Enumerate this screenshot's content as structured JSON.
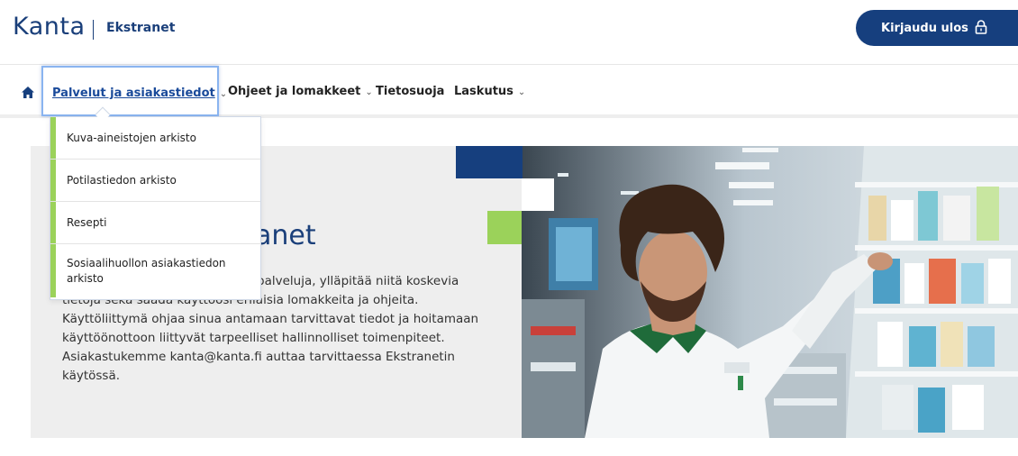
{
  "header": {
    "logo": "Kanta",
    "logo_sub": "Ekstranet",
    "logout_label": "Kirjaudu ulos"
  },
  "nav": {
    "items": [
      {
        "label": "Palvelut ja asiakastiedot",
        "has_dropdown": true,
        "active": true
      },
      {
        "label": "Ohjeet ja lomakkeet",
        "has_dropdown": true
      },
      {
        "label": "Tietosuoja",
        "has_dropdown": false
      },
      {
        "label": "Laskutus",
        "has_dropdown": true
      }
    ]
  },
  "dropdown": {
    "items": [
      "Kuva-aineistojen arkisto",
      "Potilastiedon arkisto",
      "Resepti",
      "Sosiaalihuollon asiakastiedon arkisto"
    ]
  },
  "hero": {
    "title_visible": "anet",
    "text_lines": [
      "palveluja, ylläpitää niitä koskevia",
      "tietoja sekä saada käyttöösi erilaisia lomakkeita ja ohjeita.",
      "Käyttöliittymä ohjaa sinua antamaan tarvittavat tiedot ja hoitamaan",
      "käyttöönottoon liittyvät tarpeelliset hallinnolliset toimenpiteet.",
      "Asiakastukemme kanta@kanta.fi auttaa tarvittaessa Ekstranetin",
      "käytössä."
    ]
  },
  "colors": {
    "brand_blue": "#163f7e",
    "accent_green": "#9bd25a",
    "hero_bg": "#eeeeee"
  },
  "icons": {
    "home": "home-icon",
    "lock": "lock-icon",
    "chevron": "chevron-down-icon"
  }
}
